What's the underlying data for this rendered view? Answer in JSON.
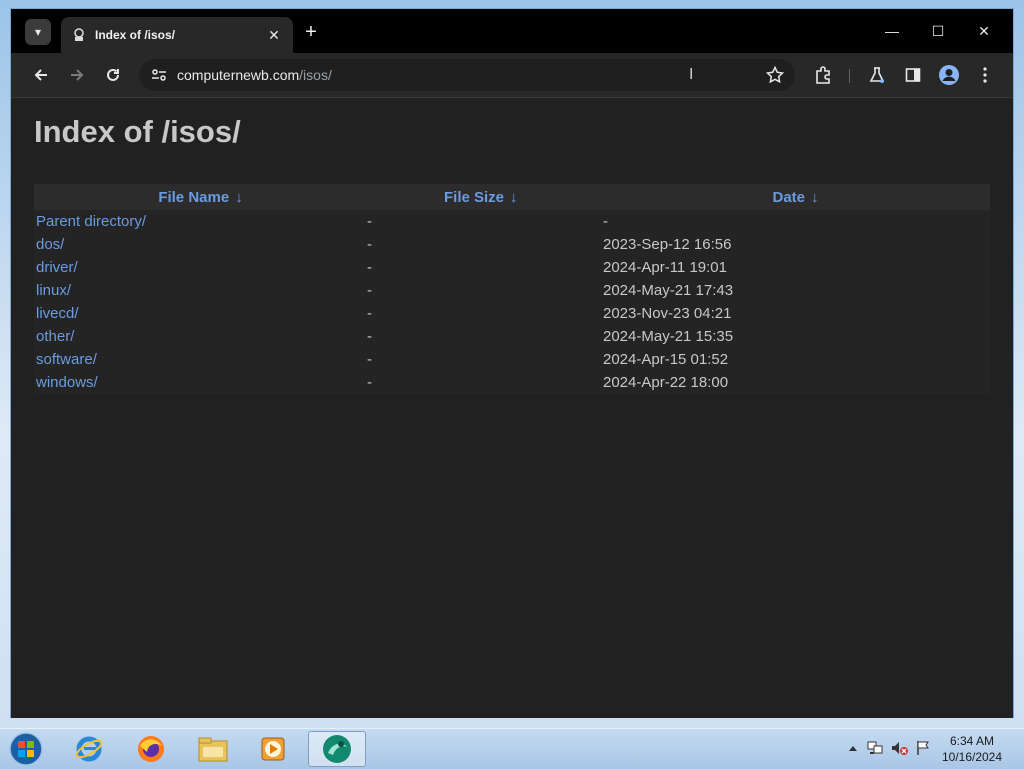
{
  "browser": {
    "tab_title": "Index of /isos/",
    "url_host": "computernewb.com",
    "url_path": "/isos/"
  },
  "page": {
    "heading": "Index of /isos/",
    "columns": [
      {
        "label": "File Name",
        "arrow": "↓"
      },
      {
        "label": "File Size",
        "arrow": "↓"
      },
      {
        "label": "Date",
        "arrow": "↓"
      }
    ],
    "rows": [
      {
        "name": "Parent directory/",
        "size": "-",
        "date": "-"
      },
      {
        "name": "dos/",
        "size": "-",
        "date": "2023-Sep-12 16:56"
      },
      {
        "name": "driver/",
        "size": "-",
        "date": "2024-Apr-11 19:01"
      },
      {
        "name": "linux/",
        "size": "-",
        "date": "2024-May-21 17:43"
      },
      {
        "name": "livecd/",
        "size": "-",
        "date": "2023-Nov-23 04:21"
      },
      {
        "name": "other/",
        "size": "-",
        "date": "2024-May-21 15:35"
      },
      {
        "name": "software/",
        "size": "-",
        "date": "2024-Apr-15 01:52"
      },
      {
        "name": "windows/",
        "size": "-",
        "date": "2024-Apr-22 18:00"
      }
    ]
  },
  "taskbar": {
    "time": "6:34 AM",
    "date": "10/16/2024"
  },
  "colors": {
    "link": "#6b9be0",
    "page_bg": "#212121",
    "heading": "#c8c8c8"
  },
  "icons": [
    "tab-search-icon",
    "favicon-icon",
    "close-tab-icon",
    "new-tab-icon",
    "minimize-icon",
    "maximize-icon",
    "close-window-icon",
    "back-icon",
    "forward-icon",
    "reload-icon",
    "site-info-icon",
    "bookmark-star-icon",
    "extensions-icon",
    "labs-icon",
    "side-panel-icon",
    "profile-icon",
    "menu-icon",
    "start-orb-icon",
    "ie-icon",
    "firefox-icon",
    "explorer-icon",
    "media-player-icon",
    "app-icon",
    "tray-arrow-icon",
    "network-icon",
    "volume-muted-icon",
    "flag-icon"
  ]
}
